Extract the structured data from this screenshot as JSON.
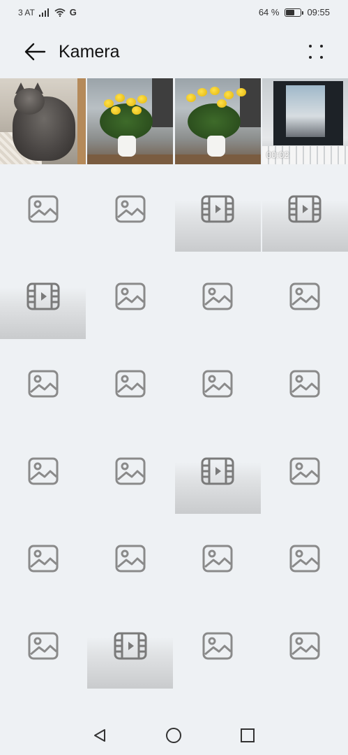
{
  "status_bar": {
    "carrier": "3 AT",
    "network": "G",
    "battery_percent": "64 %",
    "battery_level": 0.64,
    "time": "09:55"
  },
  "header": {
    "back_icon": "arrow-left-icon",
    "title": "Kamera",
    "more_icon": "more-dots-icon"
  },
  "grid": {
    "photos": [
      {
        "kind": "photo",
        "subject": "cat"
      },
      {
        "kind": "photo",
        "subject": "flowers"
      },
      {
        "kind": "photo",
        "subject": "flowers"
      },
      {
        "kind": "video",
        "subject": "screen",
        "duration": "00:02"
      }
    ],
    "placeholders": [
      "image",
      "image",
      "video",
      "video",
      "video",
      "image",
      "image",
      "image",
      "image",
      "image",
      "image",
      "image",
      "image",
      "image",
      "video",
      "image",
      "image",
      "image",
      "image",
      "image",
      "image",
      "video",
      "image",
      "image"
    ]
  },
  "nav_bar": {
    "back_icon": "triangle-back-icon",
    "home_icon": "circle-home-icon",
    "recents_icon": "square-recents-icon"
  },
  "colors": {
    "background": "#eef1f4",
    "icon_gray": "#8a8a8a",
    "text": "#111111"
  }
}
